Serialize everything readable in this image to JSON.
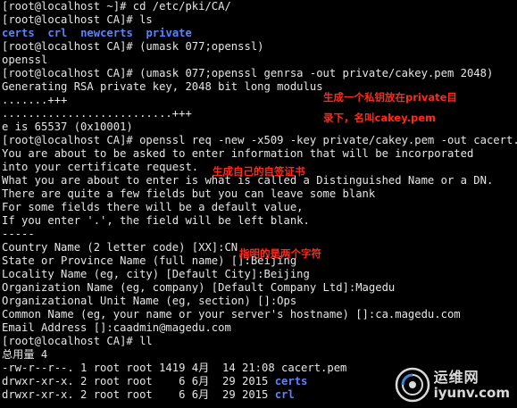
{
  "terminal": {
    "lines": [
      "[root@localhost ~]# cd /etc/pki/CA/",
      "[root@localhost CA]# ls",
      "",
      "[root@localhost CA]# (umask 077;openssl)",
      "openssl",
      "[root@localhost CA]# (umask 077;openssl genrsa -out private/cakey.pem 2048)",
      "Generating RSA private key, 2048 bit long modulus",
      ".......+++",
      "..........................+++",
      "e is 65537 (0x10001)",
      "[root@localhost CA]# openssl req -new -x509 -key private/cakey.pem -out cacert.pem",
      "You are about to be asked to enter information that will be incorporated",
      "into your certificate request.",
      "What you are about to enter is what is called a Distinguished Name or a DN.",
      "There are quite a few fields but you can leave some blank",
      "For some fields there will be a default value,",
      "If you enter '.', the field will be left blank.",
      "-----",
      "Country Name (2 letter code) [XX]:CN",
      "State or Province Name (full name) []:Beijing",
      "Locality Name (eg, city) [Default City]:Beijing",
      "Organization Name (eg, company) [Default Company Ltd]:Magedu",
      "Organizational Unit Name (eg, section) []:Ops",
      "Common Name (eg, your name or your server's hostname) []:ca.magedu.com",
      "Email Address []:caadmin@magedu.com",
      "[root@localhost CA]# ll",
      "总用量 4",
      "-rw-r--r--. 1 root root 1419 4月  14 21:08 cacert.pem",
      "",
      ""
    ],
    "ls_output": [
      "certs",
      "crl",
      "newcerts",
      "private"
    ],
    "ll_dir1_prefix": "drwxr-xr-x. 2 root root    6 6月  29 2015 ",
    "ll_dir1_name": "certs",
    "ll_dir2_prefix": "drwxr-xr-x. 2 root root    6 6月  29 2015 ",
    "ll_dir2_name": "crl"
  },
  "annotations": {
    "note1_line1": "生成一个私钥放在private目",
    "note1_line2": "录下，名叫cakey.pem",
    "note2": "生成自己的自签证书",
    "note3": "指明的是两个字符"
  },
  "watermark": {
    "cn": "运维网",
    "url": "iyunv.com"
  },
  "colors": {
    "background": "#000000",
    "text": "#e6e6e6",
    "directory": "#5b82ff",
    "annotation": "#ff2a1a"
  }
}
